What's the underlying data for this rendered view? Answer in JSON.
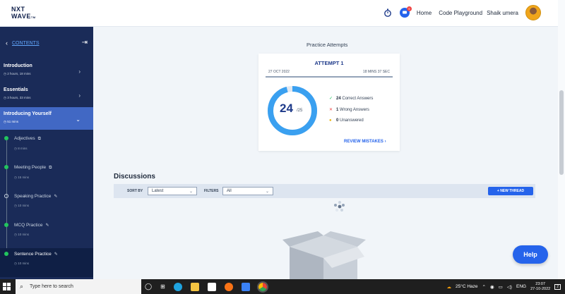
{
  "header": {
    "logo_line1": "NXT",
    "logo_line2": "WAVE",
    "logo_suffix": "TM",
    "notification_count": "9",
    "nav": [
      "Home",
      "Code Playground"
    ],
    "user_name": "Shaik umera"
  },
  "sidebar": {
    "back_label": "CONTENTS",
    "sections": [
      {
        "title": "Introduction",
        "meta": "2 hours, 18 mins"
      },
      {
        "title": "Essentials",
        "meta": "3 hours, 33 mins"
      },
      {
        "title": "Introducing Yourself",
        "meta": "51 mins"
      }
    ],
    "lessons": [
      {
        "title": "Adjectives",
        "meta": "8 mins",
        "icon": "book-icon",
        "status": "completed"
      },
      {
        "title": "Meeting People",
        "meta": "15 mins",
        "icon": "book-icon",
        "status": "completed"
      },
      {
        "title": "Speaking Practice",
        "meta": "10 mins",
        "icon": "pencil-icon",
        "status": "pending"
      },
      {
        "title": "MCQ Practice",
        "meta": "10 mins",
        "icon": "pencil-icon",
        "status": "completed"
      },
      {
        "title": "Sentence Practice",
        "meta": "10 mins",
        "icon": "pencil-icon",
        "status": "completed"
      }
    ]
  },
  "practice": {
    "heading": "Practice Attempts",
    "attempt_title": "ATTEMPT 1",
    "date": "27 OCT 2022",
    "duration": "18 MINS 37 SEC",
    "score": "24",
    "total": "/25",
    "score_fraction": 0.96,
    "correct_count": "24",
    "correct_label": "Correct Answers",
    "wrong_count": "1",
    "wrong_label": "Wrong Answers",
    "unanswered_count": "0",
    "unanswered_label": "Unanswered",
    "review_label": "REVIEW MISTAKES"
  },
  "discussions": {
    "title": "Discussions",
    "sort_label": "SORT BY",
    "sort_value": "Latest",
    "filter_label": "FILTERS",
    "filter_value": "All",
    "new_thread_label": "+ NEW THREAD"
  },
  "help_label": "Help",
  "taskbar": {
    "search_placeholder": "Type here to search",
    "weather": "25°C Haze",
    "lang": "ENG",
    "time": "23:07",
    "date": "27-10-2022",
    "notif": "2"
  },
  "colors": {
    "accent": "#2563eb",
    "sidebar": "#1a2b58",
    "sidebar_active": "#4168c4",
    "donut": "#3aa0f0",
    "correct": "#22c55e",
    "wrong": "#ef4444",
    "unanswered": "#eab308"
  }
}
